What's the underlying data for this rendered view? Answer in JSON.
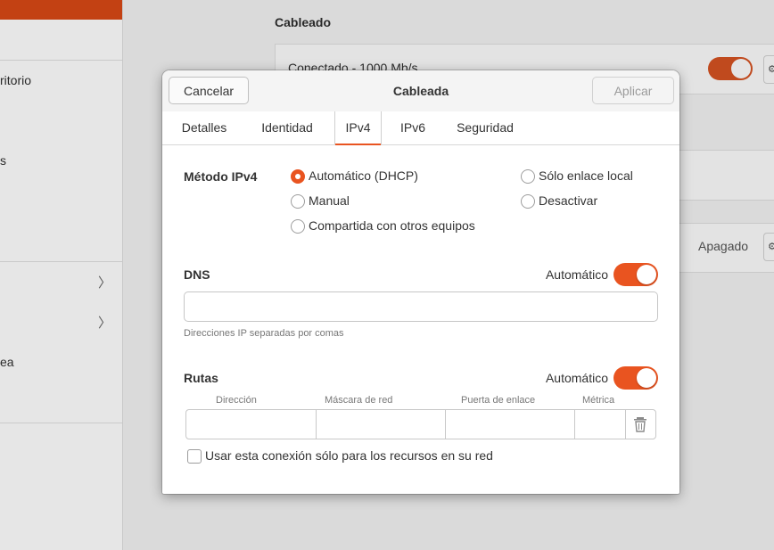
{
  "background": {
    "sidebar_items": [
      {
        "label": "ritorio"
      },
      {
        "label": "s"
      },
      {
        "label": "ea"
      }
    ],
    "section_title": "Cableado",
    "wired_status": "Conectado - 1000 Mb/s",
    "off_label": "Apagado",
    "gear_icon": "gear-icon",
    "chevron_icon": "chevron-right-icon"
  },
  "dialog": {
    "title": "Cableada",
    "cancel_label": "Cancelar",
    "apply_label": "Aplicar",
    "tabs": [
      {
        "label": "Detalles",
        "active": false
      },
      {
        "label": "Identidad",
        "active": false
      },
      {
        "label": "IPv4",
        "active": true
      },
      {
        "label": "IPv6",
        "active": false
      },
      {
        "label": "Seguridad",
        "active": false
      }
    ],
    "method": {
      "label": "Método IPv4",
      "options": [
        {
          "label": "Automático (DHCP)",
          "selected": true
        },
        {
          "label": "Manual",
          "selected": false
        },
        {
          "label": "Compartida con otros equipos",
          "selected": false
        },
        {
          "label": "Sólo enlace local",
          "selected": false
        },
        {
          "label": "Desactivar",
          "selected": false
        }
      ]
    },
    "dns": {
      "label": "DNS",
      "auto_label": "Automático",
      "auto_on": true,
      "value": "",
      "hint": "Direcciones IP separadas por comas"
    },
    "routes": {
      "label": "Rutas",
      "auto_label": "Automático",
      "auto_on": true,
      "columns": [
        "Dirección",
        "Máscara de red",
        "Puerta de enlace",
        "Métrica"
      ],
      "delete_icon": "trash-icon"
    },
    "restrict_label": "Usar esta conexión sólo para los recursos en su red",
    "restrict_checked": false
  },
  "colors": {
    "accent": "#e95420",
    "sidebar_active": "#c34113"
  }
}
